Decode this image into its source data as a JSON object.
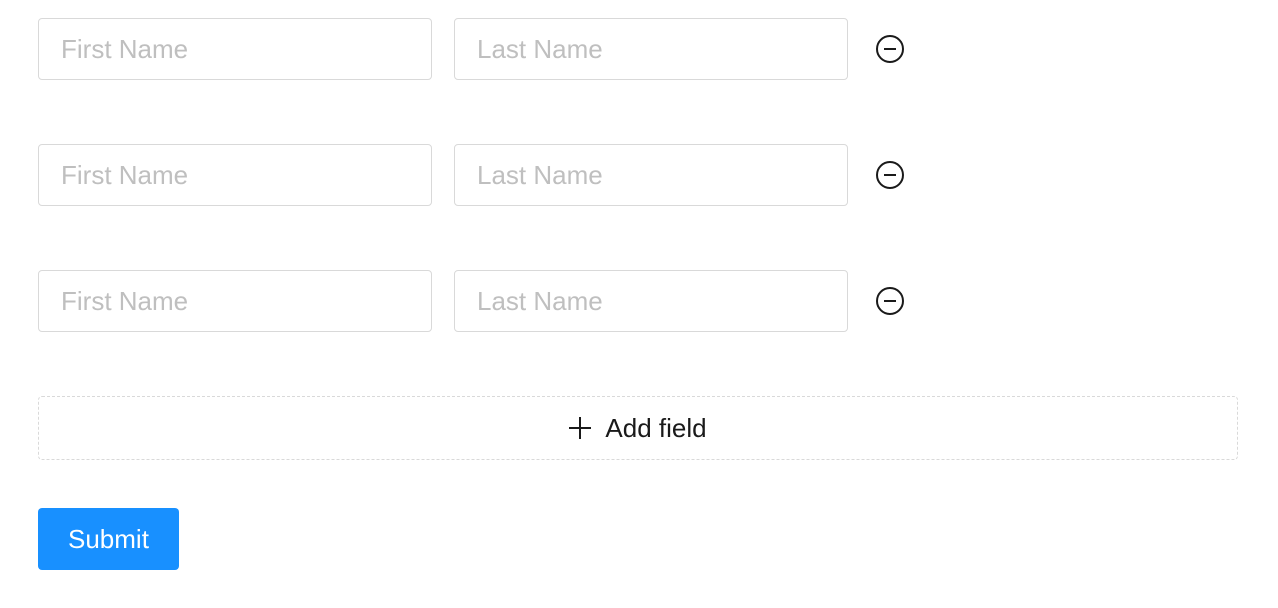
{
  "rows": [
    {
      "first_placeholder": "First Name",
      "first_value": "",
      "last_placeholder": "Last Name",
      "last_value": ""
    },
    {
      "first_placeholder": "First Name",
      "first_value": "",
      "last_placeholder": "Last Name",
      "last_value": ""
    },
    {
      "first_placeholder": "First Name",
      "first_value": "",
      "last_placeholder": "Last Name",
      "last_value": ""
    }
  ],
  "add_field_label": "Add field",
  "submit_label": "Submit"
}
